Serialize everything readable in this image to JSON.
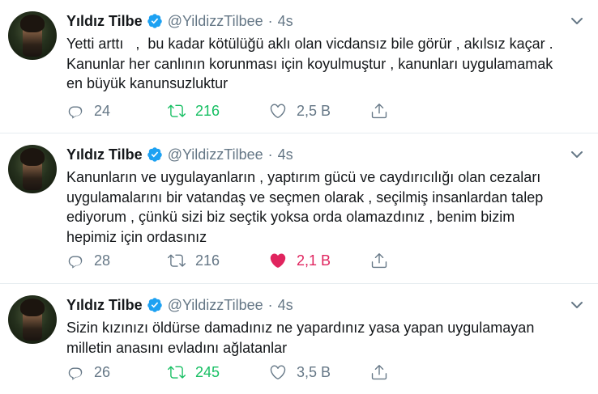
{
  "colors": {
    "retweet_active": "#17bf63",
    "like_active": "#e0245e",
    "verified": "#1da1f2",
    "muted": "#657786"
  },
  "tweets": [
    {
      "name": "Yıldız Tilbe",
      "handle": "@YildizzTilbee",
      "dot": "·",
      "time": "4s",
      "text": "Yetti arttı   ,  bu kadar kötülüğü aklı olan vicdansız bile görür , akılsız kaçar .\nKanunlar her canlının korunması için koyulmuştur , kanunları uygulamamak\nen büyük kanunsuzluktur",
      "replies": "24",
      "retweets": "216",
      "likes": "2,5 B",
      "retweeted": true,
      "liked": false
    },
    {
      "name": "Yıldız Tilbe",
      "handle": "@YildizzTilbee",
      "dot": "·",
      "time": "4s",
      "text": "Kanunların ve uygulayanların , yaptırım gücü ve caydırıcılığı olan cezaları\nuygulamalarını bir vatandaş ve seçmen olarak , seçilmiş insanlardan talep\nediyorum , çünkü sizi biz seçtik yoksa orda olamazdınız , benim bizim\nhepimiz için ordasınız",
      "replies": "28",
      "retweets": "216",
      "likes": "2,1 B",
      "retweeted": false,
      "liked": true
    },
    {
      "name": "Yıldız Tilbe",
      "handle": "@YildizzTilbee",
      "dot": "·",
      "time": "4s",
      "text": "Sizin kızınızı öldürse damadınız ne yapardınız yasa yapan uygulamayan\nmilletin anasını evladını ağlatanlar",
      "replies": "26",
      "retweets": "245",
      "likes": "3,5 B",
      "retweeted": true,
      "liked": false
    }
  ]
}
